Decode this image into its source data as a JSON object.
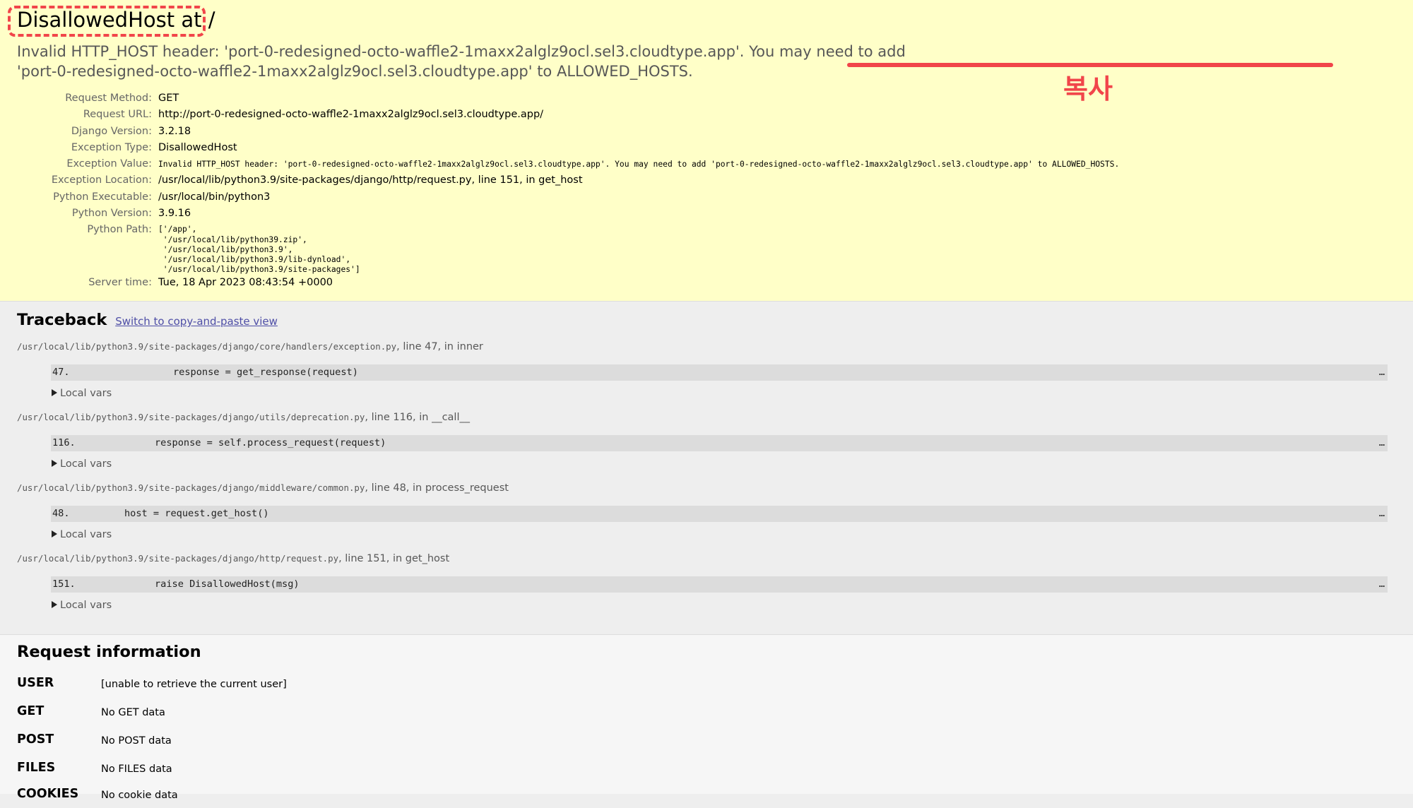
{
  "summary": {
    "title": "DisallowedHost at /",
    "message_prefix": "Invalid HTTP_HOST header: 'port-0-redesigned-octo-waffle2-1maxx2alglz9ocl.sel3.cloudtype.app'. You may need to add ",
    "message_host": "'port-0-redesigned-octo-waffle2-1maxx2alglz9ocl.sel3.cloudtype.app'",
    "message_suffix": " to ALLOWED_HOSTS.",
    "copy_note": "복사",
    "annotation_color": "#f1454a",
    "meta": {
      "request_method_label": "Request Method:",
      "request_method": "GET",
      "request_url_label": "Request URL:",
      "request_url": "http://port-0-redesigned-octo-waffle2-1maxx2alglz9ocl.sel3.cloudtype.app/",
      "django_version_label": "Django Version:",
      "django_version": "3.2.18",
      "exception_type_label": "Exception Type:",
      "exception_type": "DisallowedHost",
      "exception_value_label": "Exception Value:",
      "exception_value": "Invalid HTTP_HOST header: 'port-0-redesigned-octo-waffle2-1maxx2alglz9ocl.sel3.cloudtype.app'. You may need to add 'port-0-redesigned-octo-waffle2-1maxx2alglz9ocl.sel3.cloudtype.app' to ALLOWED_HOSTS.",
      "exception_location_label": "Exception Location:",
      "exception_location": "/usr/local/lib/python3.9/site-packages/django/http/request.py, line 151, in get_host",
      "python_executable_label": "Python Executable:",
      "python_executable": "/usr/local/bin/python3",
      "python_version_label": "Python Version:",
      "python_version": "3.9.16",
      "python_path_label": "Python Path:",
      "python_path": "['/app',\n '/usr/local/lib/python39.zip',\n '/usr/local/lib/python3.9',\n '/usr/local/lib/python3.9/lib-dynload',\n '/usr/local/lib/python3.9/site-packages']",
      "server_time_label": "Server time:",
      "server_time": "Tue, 18 Apr 2023 08:43:54 +0000"
    }
  },
  "traceback": {
    "heading": "Traceback",
    "switch_link": "Switch to copy-and-paste view",
    "frames": [
      {
        "file": "/usr/local/lib/python3.9/site-packages/django/core/handlers/exception.py",
        "where": ", line 47, in inner",
        "line_no": "47.",
        "code": "response = get_response(request)",
        "more": "…",
        "local_vars": "Local vars"
      },
      {
        "file": "/usr/local/lib/python3.9/site-packages/django/utils/deprecation.py",
        "where": ", line 116, in __call__",
        "line_no": "116.",
        "code": "response = self.process_request(request)",
        "more": "…",
        "local_vars": "Local vars"
      },
      {
        "file": "/usr/local/lib/python3.9/site-packages/django/middleware/common.py",
        "where": ", line 48, in process_request",
        "line_no": "48.",
        "code": "host = request.get_host()",
        "more": "…",
        "local_vars": "Local vars"
      },
      {
        "file": "/usr/local/lib/python3.9/site-packages/django/http/request.py",
        "where": ", line 151, in get_host",
        "line_no": "151.",
        "code": "raise DisallowedHost(msg)",
        "more": "…",
        "local_vars": "Local vars"
      }
    ]
  },
  "request_info": {
    "heading": "Request information",
    "rows": [
      {
        "label": "USER",
        "value": "[unable to retrieve the current user]"
      },
      {
        "label": "GET",
        "value": "No GET data"
      },
      {
        "label": "POST",
        "value": "No POST data"
      },
      {
        "label": "FILES",
        "value": "No FILES data"
      },
      {
        "label": "COOKIES",
        "value": "No cookie data"
      }
    ]
  }
}
